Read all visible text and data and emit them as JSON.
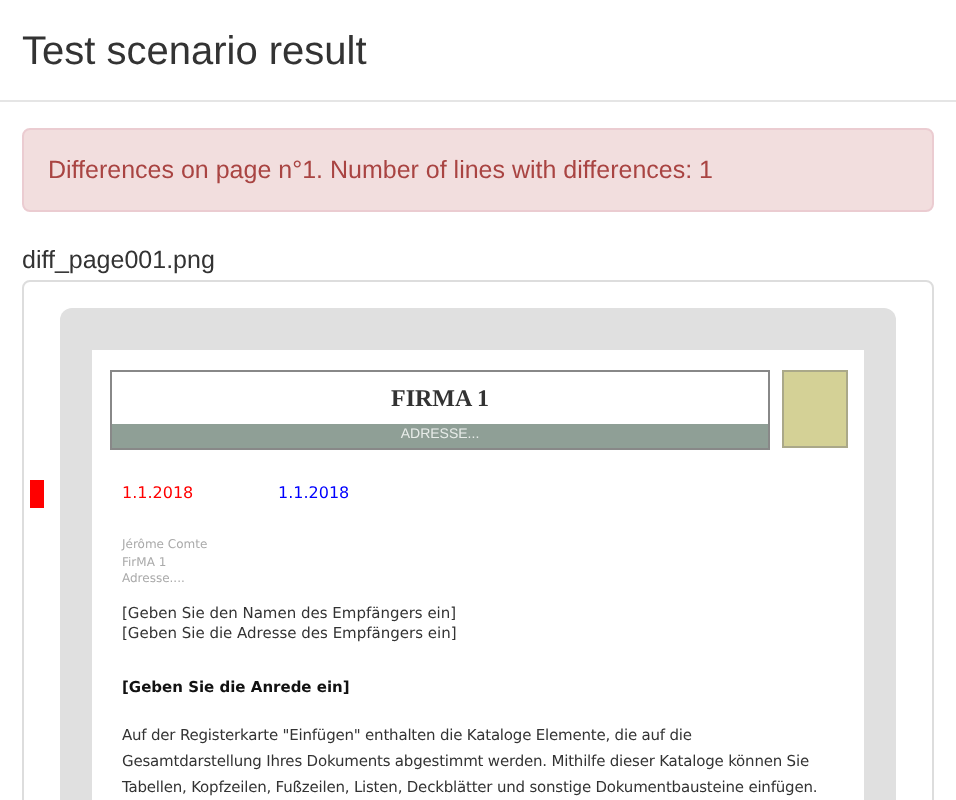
{
  "title": "Test scenario result",
  "alert": "Differences on page n°1. Number of lines with differences: 1",
  "image": {
    "filename": "diff_page001.png",
    "document": {
      "company": "FIRMA 1",
      "address": "ADRESSE...",
      "diff_markers": [
        {
          "color": "#ff0000"
        }
      ],
      "dates": [
        {
          "text": "1.1.2018",
          "color": "#ff0000"
        },
        {
          "text": "1.1.2018",
          "color": "#0000ff"
        }
      ],
      "sender": [
        "Jérôme Comte",
        "FirMA 1",
        "Adresse...."
      ],
      "recipient": [
        "[Geben Sie den Namen des Empfängers ein]",
        "[Geben Sie die Adresse des Empfängers ein]"
      ],
      "salutation": "[Geben Sie die Anrede ein]",
      "body": [
        "Auf der Registerkarte \"Einfügen\" enthalten die Kataloge Elemente, die auf die",
        "Gesamtdarstellung Ihres Dokuments abgestimmt werden. Mithilfe dieser Kataloge können Sie",
        "Tabellen, Kopfzeilen, Fußzeilen, Listen, Deckblätter und sonstige Dokumentbausteine einfügen."
      ]
    }
  }
}
